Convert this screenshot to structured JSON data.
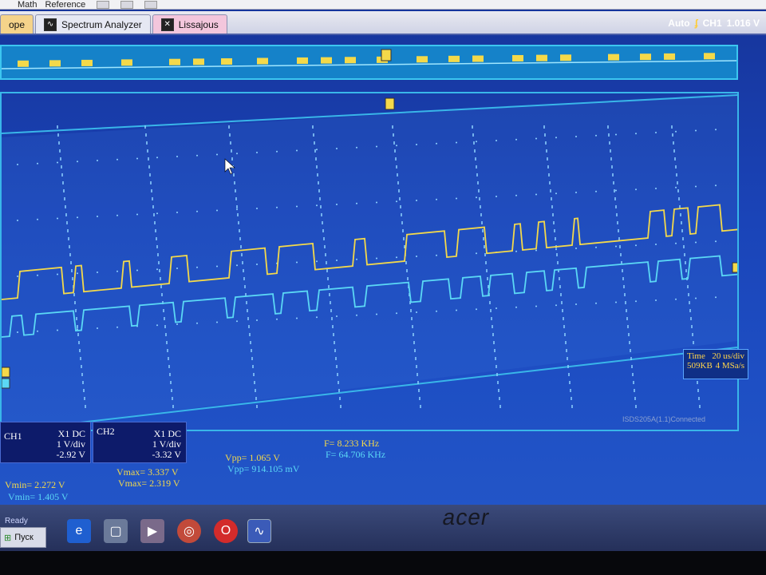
{
  "menu": {
    "items": [
      "Math",
      "Reference"
    ]
  },
  "tabs": [
    {
      "label": "ope",
      "active": true
    },
    {
      "label": "Spectrum Analyzer",
      "icon": "spectrum-icon"
    },
    {
      "label": "Lissajous",
      "icon": "lissajous-icon"
    }
  ],
  "acquisition": {
    "mode": "Auto",
    "trigger_source": "CH1",
    "trigger_level": "1.016 V"
  },
  "timebase": {
    "label": "Time",
    "per_div": "20 us/div",
    "memory": "509KB",
    "sample_rate": "4 MSa/s"
  },
  "ch1": {
    "name": "CH1",
    "probe": "X1",
    "coupling": "DC",
    "scale": "1 V/div",
    "offset": "-2.92 V",
    "color": "#f4d94a"
  },
  "ch2": {
    "name": "CH2",
    "probe": "X1",
    "coupling": "DC",
    "scale": "1 V/div",
    "offset": "-3.32 V",
    "color": "#5bd8f5"
  },
  "measurements": {
    "ch1_vmin": "Vmin= 2.272 V",
    "ch2_vmin": "Vmin= 1.405 V",
    "ch1_vmax": "Vmax= 3.337 V",
    "ch2_vmax": "Vmax= 2.319 V",
    "ch1_vpp": "Vpp= 1.065 V",
    "ch2_vpp": "Vpp= 914.105 mV",
    "ch1_freq": "F= 8.233 KHz",
    "ch2_freq": "F= 64.706 KHz"
  },
  "status": {
    "device": "ISDS205A(1.1)Connected",
    "ready": "Ready"
  },
  "taskbar": {
    "start_label": "Пуск",
    "icons": [
      "ie-icon",
      "window-icon",
      "media-icon",
      "chrome-icon",
      "opera-icon",
      "scope-app-icon"
    ]
  },
  "brand": "acer"
}
